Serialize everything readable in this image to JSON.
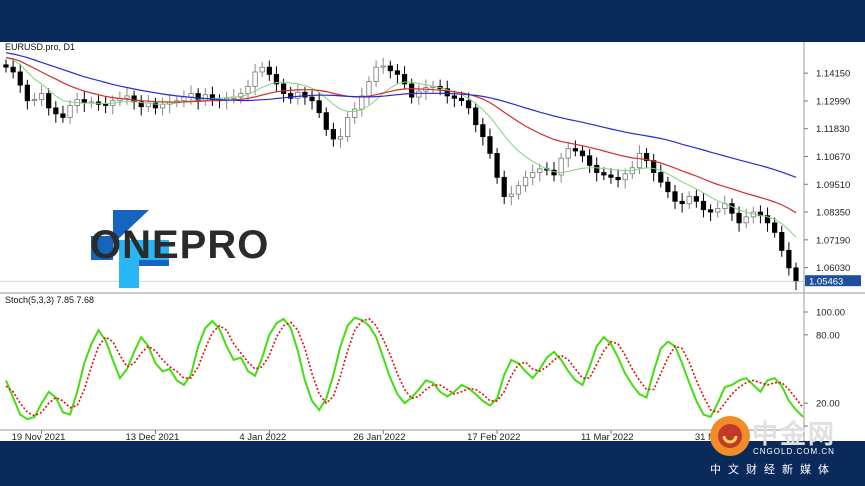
{
  "chart_data": {
    "type": "candlestick",
    "symbol_label": "EURUSD.pro, D1",
    "price_axis": {
      "ticks": [
        "1.14150",
        "1.12990",
        "1.11830",
        "1.10670",
        "1.09510",
        "1.08350",
        "1.07190",
        "1.06030"
      ],
      "tick_values": [
        1.1415,
        1.1299,
        1.1183,
        1.1067,
        1.0951,
        1.0835,
        1.0719,
        1.0603
      ],
      "ylim": [
        1.0543,
        1.1495
      ],
      "current_price": "1.05463"
    },
    "x_axis_labels": [
      "19 Nov 2021",
      "13 Dec 2021",
      "4 Jan 2022",
      "26 Jan 2022",
      "17 Feb 2022",
      "11 Mar 2022",
      "31 Mar 2022"
    ],
    "x_axis_label_index": [
      5,
      21,
      37,
      53,
      69,
      85,
      101
    ],
    "closes": [
      1.144,
      1.142,
      1.1365,
      1.13,
      1.1305,
      1.133,
      1.127,
      1.1245,
      1.123,
      1.128,
      1.1305,
      1.129,
      1.1295,
      1.1285,
      1.128,
      1.13,
      1.131,
      1.132,
      1.1295,
      1.1275,
      1.129,
      1.127,
      1.1285,
      1.1295,
      1.13,
      1.1315,
      1.133,
      1.13,
      1.1325,
      1.1305,
      1.13,
      1.131,
      1.1315,
      1.133,
      1.136,
      1.142,
      1.144,
      1.141,
      1.137,
      1.133,
      1.131,
      1.1335,
      1.1315,
      1.13,
      1.125,
      1.118,
      1.114,
      1.115,
      1.123,
      1.1265,
      1.132,
      1.138,
      1.144,
      1.1445,
      1.1425,
      1.141,
      1.137,
      1.1315,
      1.134,
      1.1355,
      1.136,
      1.135,
      1.132,
      1.131,
      1.13,
      1.127,
      1.12,
      1.115,
      1.108,
      1.098,
      1.09,
      1.091,
      1.0945,
      1.098,
      1.1,
      1.1015,
      1.101,
      1.099,
      1.106,
      1.11,
      1.109,
      1.107,
      1.103,
      1.1,
      1.099,
      1.098,
      1.097,
      1.0995,
      1.102,
      1.108,
      1.105,
      1.1,
      1.096,
      1.092,
      1.088,
      1.087,
      1.09,
      1.088,
      1.0845,
      1.0835,
      1.085,
      1.087,
      1.083,
      1.079,
      1.0815,
      1.0835,
      1.082,
      1.079,
      1.075,
      1.0675,
      1.0602,
      1.0546
    ],
    "sma_fast_label": "MA fast",
    "sma_fast": [
      1.148,
      1.147,
      1.145,
      1.142,
      1.139,
      1.137,
      1.1345,
      1.132,
      1.13,
      1.1295,
      1.1292,
      1.129,
      1.129,
      1.1289,
      1.1288,
      1.129,
      1.1293,
      1.1297,
      1.1296,
      1.1292,
      1.129,
      1.1286,
      1.1285,
      1.1287,
      1.129,
      1.1296,
      1.1301,
      1.1303,
      1.1308,
      1.131,
      1.1311,
      1.1313,
      1.1315,
      1.1318,
      1.1326,
      1.134,
      1.1356,
      1.1368,
      1.1376,
      1.1378,
      1.1374,
      1.137,
      1.1363,
      1.1352,
      1.1335,
      1.131,
      1.1285,
      1.1265,
      1.1255,
      1.1255,
      1.1263,
      1.128,
      1.1303,
      1.133,
      1.1353,
      1.137,
      1.1378,
      1.1378,
      1.1372,
      1.1367,
      1.136,
      1.1355,
      1.1345,
      1.1335,
      1.1325,
      1.131,
      1.1288,
      1.1263,
      1.1232,
      1.1194,
      1.1155,
      1.112,
      1.109,
      1.1066,
      1.1047,
      1.103,
      1.1015,
      1.1003,
      1.1,
      1.1005,
      1.1012,
      1.1018,
      1.102,
      1.102,
      1.1017,
      1.1014,
      1.101,
      1.1008,
      1.1008,
      1.1015,
      1.102,
      1.1017,
      1.1008,
      1.0994,
      1.0978,
      1.0961,
      1.0947,
      1.0932,
      1.0915,
      1.0897,
      1.0882,
      1.087,
      1.0858,
      1.0844,
      1.0834,
      1.0827,
      1.0822,
      1.0815,
      1.0805,
      1.0787,
      1.076,
      1.073
    ],
    "sma_mid_label": "MA mid",
    "sma_mid": [
      1.148,
      1.1475,
      1.1465,
      1.145,
      1.1435,
      1.142,
      1.1405,
      1.139,
      1.1375,
      1.1362,
      1.135,
      1.134,
      1.1332,
      1.1325,
      1.1318,
      1.1313,
      1.1309,
      1.1306,
      1.1303,
      1.13,
      1.1298,
      1.1296,
      1.1295,
      1.1294,
      1.1294,
      1.1295,
      1.1296,
      1.1297,
      1.1299,
      1.13,
      1.1301,
      1.1302,
      1.1304,
      1.1306,
      1.131,
      1.1316,
      1.1324,
      1.1331,
      1.1337,
      1.1341,
      1.1343,
      1.1345,
      1.1346,
      1.1346,
      1.1343,
      1.1338,
      1.1331,
      1.1324,
      1.1319,
      1.1316,
      1.1316,
      1.1319,
      1.1325,
      1.1332,
      1.1339,
      1.1345,
      1.1349,
      1.135,
      1.1349,
      1.1348,
      1.1346,
      1.1344,
      1.1341,
      1.1337,
      1.1333,
      1.1327,
      1.1318,
      1.1307,
      1.1292,
      1.1273,
      1.1252,
      1.1232,
      1.1212,
      1.1194,
      1.1178,
      1.1163,
      1.115,
      1.1138,
      1.113,
      1.1124,
      1.1118,
      1.1112,
      1.1105,
      1.1098,
      1.109,
      1.1082,
      1.1074,
      1.1067,
      1.1061,
      1.1058,
      1.1054,
      1.1048,
      1.104,
      1.103,
      1.1019,
      1.1007,
      1.0996,
      1.0985,
      1.0973,
      1.0961,
      1.095,
      1.0941,
      1.0932,
      1.0922,
      1.0913,
      1.0904,
      1.0896,
      1.0887,
      1.0877,
      1.0865,
      1.085,
      1.0832
    ],
    "sma_slow_label": "MA slow",
    "sma_slow": [
      1.15,
      1.1495,
      1.1488,
      1.148,
      1.147,
      1.146,
      1.145,
      1.144,
      1.143,
      1.142,
      1.141,
      1.14,
      1.1392,
      1.1384,
      1.1376,
      1.1368,
      1.1361,
      1.1355,
      1.1349,
      1.1343,
      1.1338,
      1.1333,
      1.1328,
      1.1324,
      1.132,
      1.1317,
      1.1314,
      1.1311,
      1.1309,
      1.1307,
      1.1305,
      1.1303,
      1.1302,
      1.1301,
      1.1301,
      1.1302,
      1.1304,
      1.1306,
      1.1309,
      1.1312,
      1.1315,
      1.1318,
      1.132,
      1.1322,
      1.1323,
      1.1323,
      1.1322,
      1.132,
      1.1318,
      1.1317,
      1.1316,
      1.1316,
      1.1317,
      1.1319,
      1.1322,
      1.1325,
      1.1328,
      1.133,
      1.1331,
      1.1331,
      1.1331,
      1.1331,
      1.133,
      1.1329,
      1.1327,
      1.1325,
      1.1322,
      1.1318,
      1.1312,
      1.1305,
      1.1297,
      1.1288,
      1.1279,
      1.127,
      1.1261,
      1.1252,
      1.1244,
      1.1236,
      1.1229,
      1.1222,
      1.1216,
      1.121,
      1.1203,
      1.1196,
      1.1189,
      1.1182,
      1.1175,
      1.1169,
      1.1163,
      1.1158,
      1.1153,
      1.1148,
      1.1142,
      1.1135,
      1.1127,
      1.1118,
      1.111,
      1.1102,
      1.1094,
      1.1085,
      1.1077,
      1.1069,
      1.1061,
      1.1053,
      1.1045,
      1.1037,
      1.1029,
      1.1021,
      1.1012,
      1.1002,
      1.0991,
      1.098
    ],
    "stoch_label": "Stoch(5,3,3) 7.85 7.68",
    "stoch_axis": {
      "ticks": [
        "100.00",
        "80.00",
        "20.00",
        "0.00"
      ],
      "tick_values": [
        100,
        80,
        20,
        0
      ],
      "ylim": [
        0,
        100
      ]
    },
    "stoch_k": [
      40,
      25,
      10,
      6,
      8,
      20,
      30,
      25,
      12,
      10,
      30,
      55,
      72,
      84,
      75,
      58,
      42,
      50,
      65,
      78,
      70,
      55,
      48,
      50,
      40,
      36,
      45,
      70,
      86,
      92,
      85,
      70,
      58,
      60,
      48,
      44,
      60,
      80,
      90,
      94,
      86,
      66,
      40,
      22,
      14,
      24,
      45,
      70,
      88,
      95,
      93,
      88,
      78,
      60,
      42,
      28,
      20,
      25,
      32,
      40,
      38,
      30,
      26,
      30,
      36,
      33,
      28,
      22,
      18,
      24,
      45,
      58,
      55,
      48,
      42,
      50,
      60,
      65,
      58,
      48,
      40,
      36,
      52,
      70,
      78,
      72,
      60,
      46,
      36,
      28,
      25,
      48,
      68,
      74,
      70,
      55,
      38,
      22,
      10,
      8,
      20,
      34,
      36,
      40,
      42,
      36,
      30,
      40,
      42,
      35,
      22,
      14,
      8
    ],
    "stoch_d": [
      35,
      30,
      20,
      12,
      9,
      12,
      20,
      25,
      22,
      16,
      18,
      32,
      52,
      70,
      78,
      74,
      62,
      52,
      55,
      64,
      70,
      66,
      58,
      52,
      48,
      42,
      42,
      52,
      68,
      82,
      88,
      84,
      72,
      64,
      56,
      50,
      52,
      62,
      78,
      88,
      91,
      84,
      68,
      46,
      28,
      20,
      26,
      44,
      66,
      84,
      92,
      94,
      88,
      76,
      62,
      46,
      32,
      24,
      26,
      32,
      36,
      36,
      32,
      28,
      30,
      33,
      32,
      28,
      22,
      22,
      30,
      44,
      54,
      56,
      50,
      48,
      52,
      58,
      62,
      58,
      50,
      42,
      42,
      54,
      66,
      74,
      72,
      62,
      50,
      40,
      32,
      32,
      46,
      60,
      70,
      68,
      56,
      40,
      26,
      14,
      12,
      20,
      28,
      34,
      38,
      40,
      38,
      36,
      38,
      38,
      32,
      24,
      16
    ]
  },
  "logo": {
    "text": "ONEPRO"
  },
  "watermark": {
    "name": "中金网",
    "url": "CNGOLD.COM.CN",
    "tagline": "中文财经新媒体"
  },
  "colors": {
    "frame": "#0b2a5c",
    "bull": "#cccccc",
    "bear": "#000000",
    "sma_fast": "#7fd67f",
    "sma_mid": "#d62b2b",
    "sma_slow": "#2a2ad6",
    "stoch_k": "#44dd11",
    "stoch_d": "#e01010",
    "price_tag": "#1d4f9c",
    "logo_blue": "#1565c0",
    "logo_cyan": "#29b6f6"
  }
}
